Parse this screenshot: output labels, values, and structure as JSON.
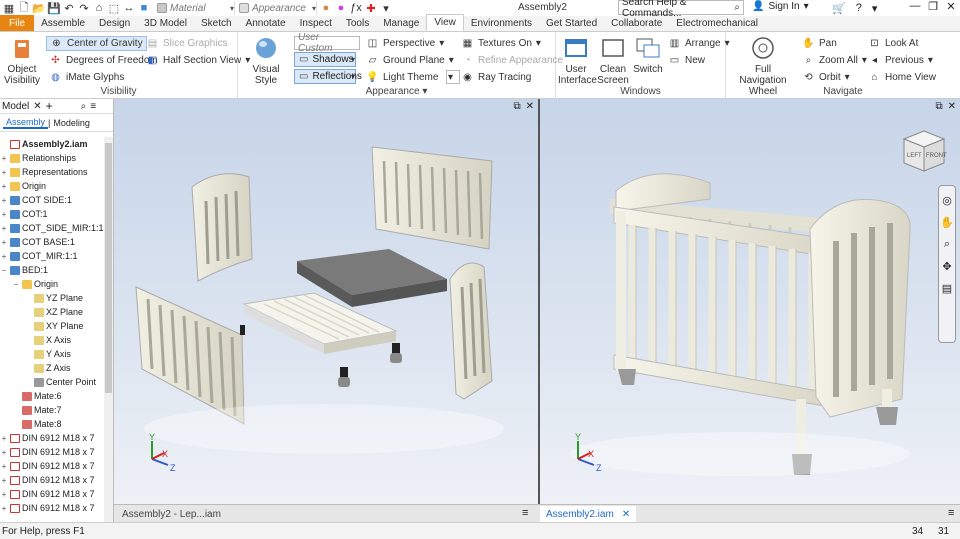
{
  "titlebar": {
    "file_tab": "File",
    "material_placeholder": "Material",
    "appearance_placeholder": "Appearance",
    "document_title": "Assembly2",
    "search_placeholder": "Search Help & Commands...",
    "sign_in": "Sign In"
  },
  "tabs": [
    "Assemble",
    "Design",
    "3D Model",
    "Sketch",
    "Annotate",
    "Inspect",
    "Tools",
    "Manage",
    "View",
    "Environments",
    "Get Started",
    "Collaborate",
    "Electromechanical"
  ],
  "active_tab": "View",
  "ribbon": {
    "visibility": {
      "label": "Visibility",
      "object_visibility": "Object Visibility",
      "center_of_gravity": "Center of Gravity",
      "degrees_of_freedom": "Degrees of Freedom",
      "imate_glyphs": "iMate Glyphs",
      "slice_graphics": "Slice Graphics",
      "half_section_view": "Half Section View"
    },
    "appearance": {
      "label": "Appearance",
      "visual_style": "Visual Style",
      "user_custom": "User Custom",
      "shadows": "Shadows",
      "reflections": "Reflections",
      "perspective": "Perspective",
      "ground_plane": "Ground Plane",
      "light_theme": "Light Theme",
      "textures_on": "Textures On",
      "refine_appearance": "Refine Appearance",
      "ray_tracing": "Ray Tracing"
    },
    "windows": {
      "label": "Windows",
      "user_interface": "User Interface",
      "clean_screen": "Clean Screen",
      "switch": "Switch",
      "arrange": "Arrange",
      "new": "New"
    },
    "navigate": {
      "label": "Navigate",
      "full_navigation_wheel": "Full Navigation Wheel",
      "pan": "Pan",
      "zoom_all": "Zoom All",
      "orbit": "Orbit",
      "look_at": "Look At",
      "previous": "Previous",
      "home_view": "Home View"
    }
  },
  "browser": {
    "title": "Model",
    "tab_assembly": "Assembly",
    "tab_modeling": "Modeling",
    "items": [
      {
        "label": "Assembly2.iam",
        "level": 0,
        "exp": "",
        "icon": "asm",
        "bold": true
      },
      {
        "label": "Relationships",
        "level": 0,
        "exp": "+",
        "icon": "rel"
      },
      {
        "label": "Representations",
        "level": 0,
        "exp": "+",
        "icon": "rep"
      },
      {
        "label": "Origin",
        "level": 0,
        "exp": "+",
        "icon": "folder"
      },
      {
        "label": "COT SIDE:1",
        "level": 0,
        "exp": "+",
        "icon": "part"
      },
      {
        "label": "COT:1",
        "level": 0,
        "exp": "+",
        "icon": "part"
      },
      {
        "label": "COT_SIDE_MIR:1:1",
        "level": 0,
        "exp": "+",
        "icon": "part"
      },
      {
        "label": "COT BASE:1",
        "level": 0,
        "exp": "+",
        "icon": "part"
      },
      {
        "label": "COT_MIR:1:1",
        "level": 0,
        "exp": "+",
        "icon": "part"
      },
      {
        "label": "BED:1",
        "level": 0,
        "exp": "−",
        "icon": "part"
      },
      {
        "label": "Origin",
        "level": 1,
        "exp": "−",
        "icon": "folder"
      },
      {
        "label": "YZ Plane",
        "level": 2,
        "exp": "",
        "icon": "plane"
      },
      {
        "label": "XZ Plane",
        "level": 2,
        "exp": "",
        "icon": "plane"
      },
      {
        "label": "XY Plane",
        "level": 2,
        "exp": "",
        "icon": "plane"
      },
      {
        "label": "X Axis",
        "level": 2,
        "exp": "",
        "icon": "axis"
      },
      {
        "label": "Y Axis",
        "level": 2,
        "exp": "",
        "icon": "axis"
      },
      {
        "label": "Z Axis",
        "level": 2,
        "exp": "",
        "icon": "axis"
      },
      {
        "label": "Center Point",
        "level": 2,
        "exp": "",
        "icon": "point"
      },
      {
        "label": "Mate:6",
        "level": 1,
        "exp": "",
        "icon": "mate"
      },
      {
        "label": "Mate:7",
        "level": 1,
        "exp": "",
        "icon": "mate"
      },
      {
        "label": "Mate:8",
        "level": 1,
        "exp": "",
        "icon": "mate"
      },
      {
        "label": "DIN 6912 M18 x 7",
        "level": 0,
        "exp": "+",
        "icon": "warn"
      },
      {
        "label": "DIN 6912 M18 x 7",
        "level": 0,
        "exp": "+",
        "icon": "warn"
      },
      {
        "label": "DIN 6912 M18 x 7",
        "level": 0,
        "exp": "+",
        "icon": "warn"
      },
      {
        "label": "DIN 6912 M18 x 7",
        "level": 0,
        "exp": "+",
        "icon": "warn"
      },
      {
        "label": "DIN 6912 M18 x 7",
        "level": 0,
        "exp": "+",
        "icon": "warn"
      },
      {
        "label": "DIN 6912 M18 x 7",
        "level": 0,
        "exp": "+",
        "icon": "warn"
      }
    ]
  },
  "doc_tabs": {
    "left": "Assembly2 - Lep...iam",
    "right": "Assembly2.iam"
  },
  "status": {
    "help": "For Help, press F1",
    "count1": "34",
    "count2": "31"
  },
  "viewcube": {
    "left": "LEFT",
    "front": "FRONT"
  },
  "colors": {
    "file_tab": "#e68512",
    "accent": "#1b6ac9",
    "viewport_top": "#c7d5e9",
    "viewport_bottom": "#eef1f6"
  }
}
